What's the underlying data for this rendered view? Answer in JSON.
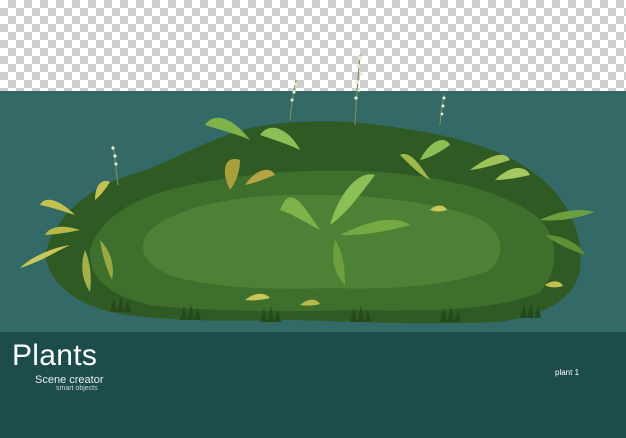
{
  "footer": {
    "title": "Plants",
    "subtitle": "Scene creator",
    "caption": "smart objects",
    "tag": "plant 1"
  },
  "colors": {
    "stage_bg": "#336a67",
    "footer_bg": "#1d4c4d",
    "transparency_light": "#ffffff",
    "transparency_dark": "#cfcfcf"
  }
}
